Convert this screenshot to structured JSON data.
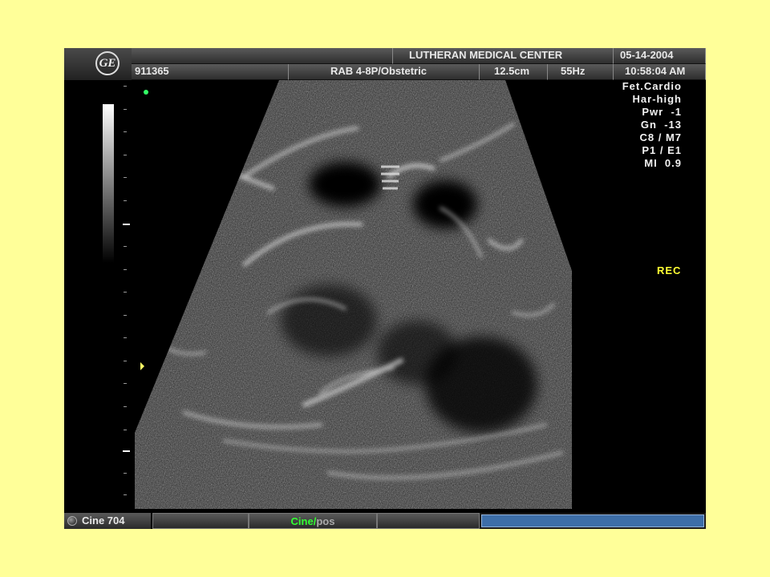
{
  "header": {
    "logo_text": "GE",
    "facility": "LUTHERAN MEDICAL CENTER",
    "date": "05-14-2004",
    "patient_id": "911365",
    "probe_preset": "RAB 4-8P/Obstetric",
    "depth": "12.5cm",
    "frame_rate": "55Hz",
    "time": "10:58:04 AM"
  },
  "parameters": [
    "Fet.Cardio",
    "Har-high",
    "Pwr  -1",
    "Gn  -13",
    "C8 / M7",
    "P1 / E1",
    "MI  0.9"
  ],
  "status": {
    "rec": "REC"
  },
  "footer": {
    "cine_label": "Cine 704",
    "cine_word": "Cine",
    "cine_separator": "/",
    "cine_pos": "pos"
  },
  "colors": {
    "page_bg": "#ffff99",
    "rec": "#ffff33",
    "cine_green": "#33ff33",
    "progress_bar": "#3d6ea8"
  },
  "icons": [
    "ge-logo-icon",
    "focus-marker-icon",
    "orientation-dot-icon",
    "cine-knob-icon"
  ]
}
